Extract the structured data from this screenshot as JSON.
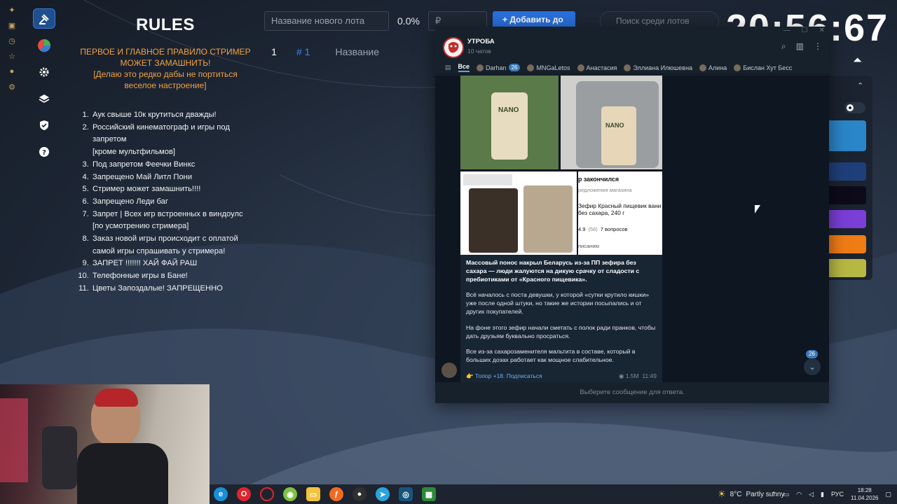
{
  "rules": {
    "title": "RULES",
    "lead": "ПЕРВОЕ И ГЛАВНОЕ ПРАВИЛО СТРИМЕР МОЖЕТ ЗАМАШНИТЬ!\n[Делаю это редко дабы не портиться веселое настроение]",
    "items": [
      "Аук свыше 10к крутиться дважды!",
      "Российский кинематограф и игры  под запретом\n[кроме мультфильмов]",
      "Под запретом Феечки Винкс",
      "Запрещено Май Литл Пони",
      "Стример может замашнить!!!!",
      "Запрещено Леди баг",
      "Запрет | Всех игр встроенных в виндоулс\n[по усмотрению стримера]",
      "Заказ новой игры происходит с оплатой самой игры спрашивать у стримера!",
      "ЗАПРЕТ !!!!!!! ХАЙ ФАЙ РАШ",
      "Телефонные игры в Бане!",
      "Цветы Запоздалые! ЗАПРЕЩЕННО"
    ]
  },
  "auction": {
    "lot_placeholder": "Название нового лота",
    "percent": "0.0%",
    "currency_placeholder": "₽",
    "add_button": "+ Добавить до",
    "search_placeholder": "Поиск среди лотов",
    "timer": "20:56:67",
    "row_number": "1",
    "row_hash": "# 1",
    "col_name": "Название"
  },
  "telegram": {
    "window_controls": [
      "—",
      "☐",
      "✕"
    ],
    "channel_title": "УТРОБА",
    "channel_subtitle": "10 чатов",
    "tabs": [
      {
        "label": "Все",
        "active": true
      },
      {
        "label": "Darhan",
        "badge": "26"
      },
      {
        "label": "MNGaLetos"
      },
      {
        "label": "Анастасия"
      },
      {
        "label": "Эллиана Илюшевна"
      },
      {
        "label": "Алина"
      },
      {
        "label": "Бислан Хут Бесс"
      }
    ],
    "photo_labels": {
      "product": "NANO",
      "sold_out": "р закончился",
      "store_line": "редложения магазина",
      "product_name": "Зефир Красный пищевик вани без сахара, 240 г",
      "rating": "4.9",
      "rating_count": "(56)",
      "questions": "7 вопросов",
      "subscribe": "писанию"
    },
    "post": {
      "p1": "Массовый понос накрыл Беларусь из-за ПП зефира без сахара — люди жалуются на дикую срачку от сладости с пребиотиками от «Красного пищевика».",
      "p2": "Всё началось с поста девушки, у которой «сутки крутило кишки» уже после одной штуки, но такие же истории посыпались и от других покупателей.",
      "p3": "На фоне этого зефир начали сметать с полок ради пранков, чтобы дать друзьям буквально просраться.",
      "p4": "Все из-за сахарозаменителя мальтита в составе, который в больших дозах работает как мощное слабительное.",
      "link": "👉 Топор +18. Подписаться",
      "views": "1.5M",
      "time": "11:49"
    },
    "unread_badge": "26",
    "footer": "Выберите сообщение для ответа."
  },
  "taskbar": {
    "weather_temp": "8°C",
    "weather_text": "Partly sunny",
    "lang": "РУС",
    "time": "18:28",
    "date": "11.04.2026",
    "icons": [
      "edge-icon",
      "opera-icon",
      "opera-gx-icon",
      "android-icon",
      "explorer-icon",
      "firefox-icon",
      "obs-icon",
      "telegram-icon",
      "steam-icon",
      "app-icon"
    ]
  },
  "colors": {
    "accent_orange": "#f1a245",
    "accent_blue": "#2a6fdc",
    "telegram_bg": "#17212b",
    "link_blue": "#6cb4ef"
  }
}
